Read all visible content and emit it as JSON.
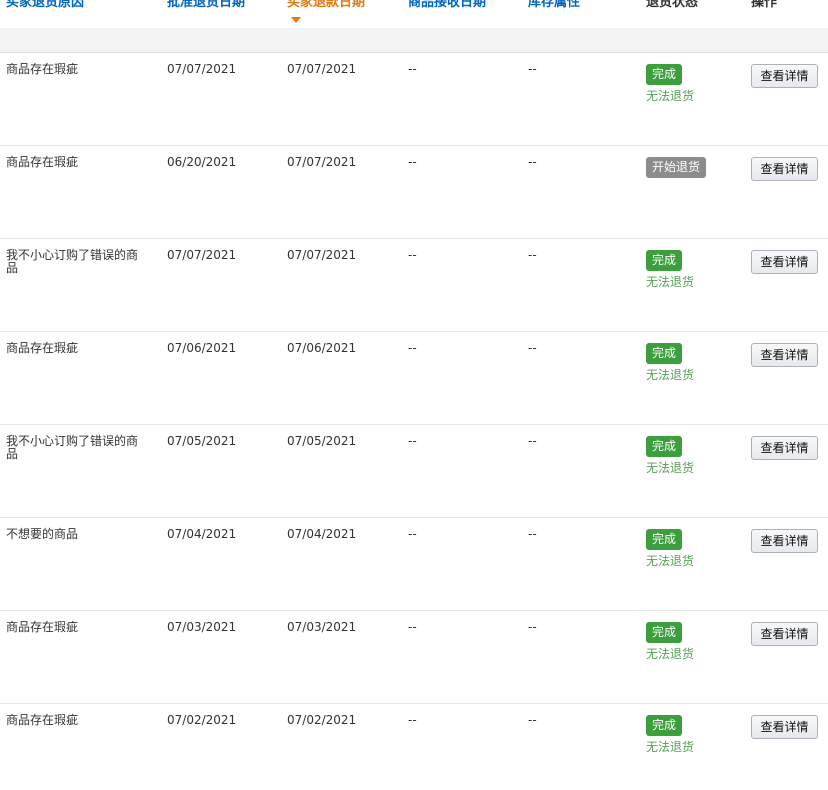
{
  "table": {
    "headers": {
      "reason": "买家退货原因",
      "approve_date": "批准退货日期",
      "refund_date": "买家退款日期",
      "receive_date": "商品接收日期",
      "stock_attr": "库存属性",
      "status": "退货状态",
      "action": "操作"
    },
    "sorted_column": "refund_date",
    "rows": [
      {
        "reason": "商品存在瑕疵",
        "approve_date": "07/07/2021",
        "refund_date": "07/07/2021",
        "receive_date": "--",
        "stock_attr": "--",
        "status": "完成",
        "status_color": "green",
        "status_note": "无法退货",
        "action": "查看详情"
      },
      {
        "reason": "商品存在瑕疵",
        "approve_date": "06/20/2021",
        "refund_date": "07/07/2021",
        "receive_date": "--",
        "stock_attr": "--",
        "status": "开始退货",
        "status_color": "gray",
        "status_note": "",
        "action": "查看详情"
      },
      {
        "reason": "我不小心订购了错误的商品",
        "approve_date": "07/07/2021",
        "refund_date": "07/07/2021",
        "receive_date": "--",
        "stock_attr": "--",
        "status": "完成",
        "status_color": "green",
        "status_note": "无法退货",
        "action": "查看详情"
      },
      {
        "reason": "商品存在瑕疵",
        "approve_date": "07/06/2021",
        "refund_date": "07/06/2021",
        "receive_date": "--",
        "stock_attr": "--",
        "status": "完成",
        "status_color": "green",
        "status_note": "无法退货",
        "action": "查看详情"
      },
      {
        "reason": "我不小心订购了错误的商品",
        "approve_date": "07/05/2021",
        "refund_date": "07/05/2021",
        "receive_date": "--",
        "stock_attr": "--",
        "status": "完成",
        "status_color": "green",
        "status_note": "无法退货",
        "action": "查看详情"
      },
      {
        "reason": "不想要的商品",
        "approve_date": "07/04/2021",
        "refund_date": "07/04/2021",
        "receive_date": "--",
        "stock_attr": "--",
        "status": "完成",
        "status_color": "green",
        "status_note": "无法退货",
        "action": "查看详情"
      },
      {
        "reason": "商品存在瑕疵",
        "approve_date": "07/03/2021",
        "refund_date": "07/03/2021",
        "receive_date": "--",
        "stock_attr": "--",
        "status": "完成",
        "status_color": "green",
        "status_note": "无法退货",
        "action": "查看详情"
      },
      {
        "reason": "商品存在瑕疵",
        "approve_date": "07/02/2021",
        "refund_date": "07/02/2021",
        "receive_date": "--",
        "stock_attr": "--",
        "status": "完成",
        "status_color": "green",
        "status_note": "无法退货",
        "action": "查看详情"
      }
    ]
  },
  "colors": {
    "header_link": "#0066c0",
    "header_sorted": "#e47911",
    "status_complete": "#3c9e3c",
    "status_started": "#8c8c8c",
    "status_note": "#55a055"
  },
  "icons": {
    "sort_indicator": "sort-desc-icon"
  }
}
